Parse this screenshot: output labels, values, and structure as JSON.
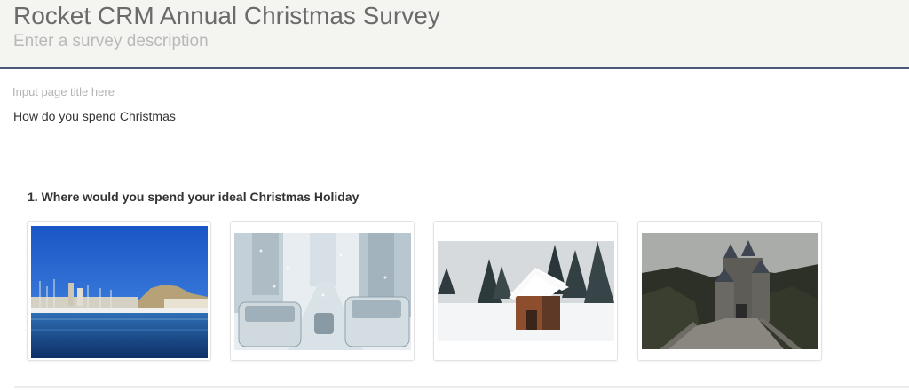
{
  "survey": {
    "title": "Rocket CRM Annual Christmas Survey",
    "description_placeholder": "Enter a survey description"
  },
  "page": {
    "title_placeholder": "Input page title here",
    "description": "How do you spend Christmas"
  },
  "question": {
    "number": "1.",
    "title": "1. Where would you spend your ideal Christmas Holiday",
    "type": "image-picker",
    "choices": [
      {
        "name": "harbor-city-photo",
        "scene": "sunny harbor city with marina"
      },
      {
        "name": "snowy-city-traffic-photo",
        "scene": "snowy city street with taxis"
      },
      {
        "name": "snowy-cabin-photo",
        "scene": "wooden cabin in snowy forest"
      },
      {
        "name": "castle-photo",
        "scene": "medieval castle on a hill"
      }
    ]
  },
  "colors": {
    "header_bg": "#f4f4f1",
    "header_border": "#4f587a",
    "title_text": "#6b6b6b",
    "placeholder_text": "#b9b9b9",
    "body_text": "#333333"
  }
}
